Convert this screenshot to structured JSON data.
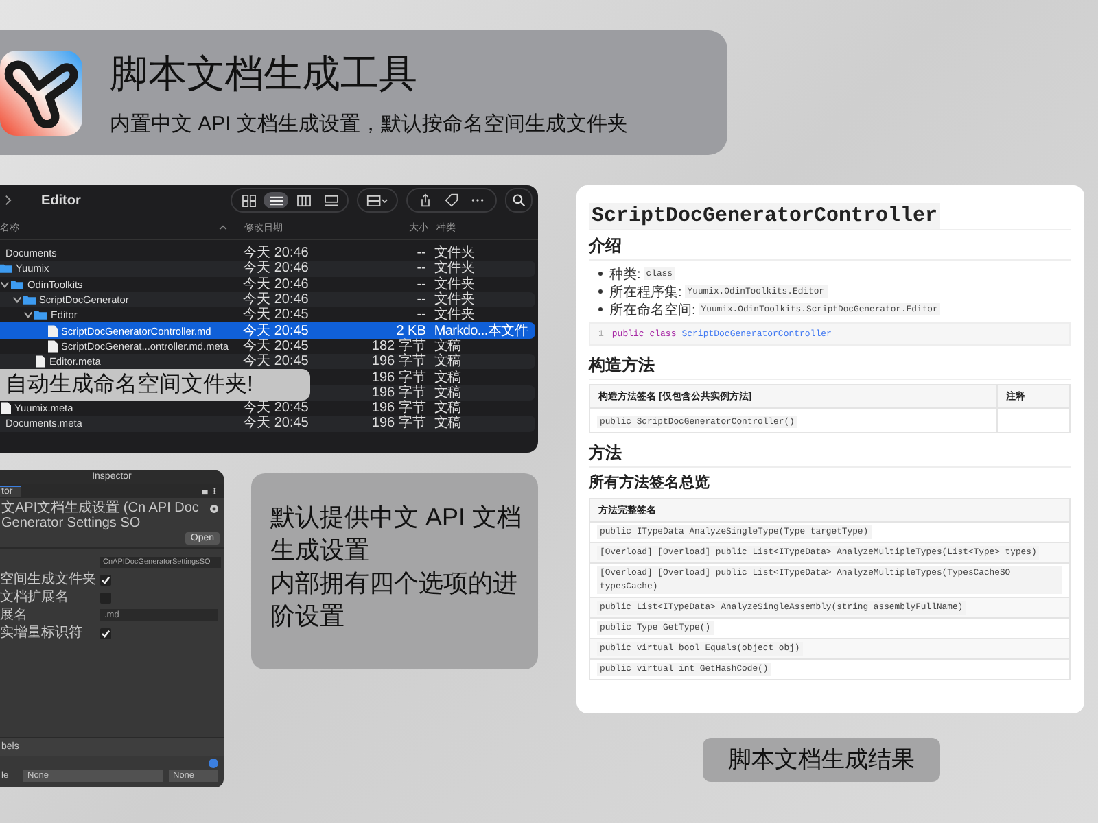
{
  "banner": {
    "title": "脚本文档生成工具",
    "subtitle": "内置中文 API 文档生成设置，默认按命名空间生成文件夹"
  },
  "finder": {
    "title": "Editor",
    "view_modes": [
      {
        "kind": "icons",
        "selected": false
      },
      {
        "kind": "list",
        "selected": true
      },
      {
        "kind": "columns",
        "selected": false
      },
      {
        "kind": "gallery",
        "selected": false
      }
    ],
    "columns": [
      "名称",
      "修改日期",
      "大小",
      "种类"
    ],
    "rows": [
      {
        "name": "Documents",
        "date": "今天 20:46",
        "size": "--",
        "kind_label": "文件夹",
        "selected": false,
        "children": [
          {
            "kind": "folder",
            "name": "Yuumix",
            "date": "今天 20:46",
            "size": "--",
            "kind_label": "文件夹",
            "selected": false,
            "children": [
              {
                "kind": "folder",
                "name": "OdinToolkits",
                "date": "今天 20:46",
                "size": "--",
                "kind_label": "文件夹",
                "selected": false,
                "expanded": true,
                "children": [
                  {
                    "kind": "folder",
                    "name": "ScriptDocGenerator",
                    "date": "今天 20:46",
                    "size": "--",
                    "kind_label": "文件夹",
                    "selected": false,
                    "expanded": true,
                    "children": [
                      {
                        "kind": "folder",
                        "name": "Editor",
                        "date": "今天 20:45",
                        "size": "--",
                        "kind_label": "文件夹",
                        "selected": false,
                        "expanded": true,
                        "children": [
                          {
                            "kind": "file",
                            "name": "ScriptDocGeneratorController.md",
                            "date": "今天 20:45",
                            "size": "2 KB",
                            "kind_label": "Markdo...本文件",
                            "selected": true
                          },
                          {
                            "kind": "file",
                            "name": "ScriptDocGenerat...ontroller.md.meta",
                            "date": "今天 20:45",
                            "size": "182 字节",
                            "kind_label": "文稿",
                            "selected": false
                          }
                        ]
                      },
                      {
                        "kind": "file",
                        "name": "Editor.meta",
                        "date": "今天 20:45",
                        "size": "196 字节",
                        "kind_label": "文稿",
                        "selected": false
                      }
                    ]
                  },
                  {
                    "size": "196 字节",
                    "kind_label": "文稿",
                    "selected": false
                  }
                ]
              },
              {
                "size": "196 字节",
                "kind_label": "文稿",
                "selected": false
              }
            ]
          },
          {
            "kind": "file",
            "name": "Yuumix.meta",
            "date": "今天 20:45",
            "size": "196 字节",
            "kind_label": "文稿",
            "selected": false
          }
        ]
      },
      {
        "name": "Documents.meta",
        "date": "今天 20:45",
        "size": "196 字节",
        "kind_label": "文稿",
        "selected": false
      }
    ],
    "callout": "自动生成命名空间文件夹!"
  },
  "inspector": {
    "title": "Inspector",
    "tab": "tor",
    "header": "文API文档生成设置 (Cn API Doc Generator Settings SO",
    "open_button": "Open",
    "fields": [
      {
        "kind": "object",
        "value": "CnAPIDocGeneratorSettingsSO"
      },
      {
        "kind": "checkbox",
        "label": "空间生成文件夹",
        "checked": true
      },
      {
        "kind": "checkbox",
        "label": "文档扩展名",
        "checked": false
      },
      {
        "kind": "text",
        "label": "展名",
        "value": ".md"
      },
      {
        "kind": "checkbox",
        "label": "实增量标识符",
        "checked": true
      }
    ],
    "section": "bels",
    "dropdown_label": "le",
    "dropdowns": [
      "None",
      "None"
    ]
  },
  "note": {
    "lines": [
      "默认提供中文 API 文档生成设置",
      "内部拥有四个选项的进阶设置"
    ]
  },
  "doc": {
    "title": "ScriptDocGeneratorController",
    "intro": {
      "heading": "介绍",
      "items": [
        {
          "label": "种类:",
          "code": "class"
        },
        {
          "label": "所在程序集:",
          "code": "Yuumix.OdinToolkits.Editor"
        },
        {
          "label": "所在命名空间:",
          "code": "Yuumix.OdinToolkits.ScriptDocGenerator.Editor"
        }
      ],
      "code_line": {
        "number": "1",
        "keyword": "public class",
        "name": "ScriptDocGeneratorController"
      }
    },
    "constructors": {
      "heading": "构造方法",
      "columns": [
        "构造方法签名 [仅包含公共实例方法]",
        "注释"
      ],
      "rows": [
        "public ScriptDocGeneratorController()"
      ]
    },
    "methods": {
      "heading": "方法",
      "subheading": "所有方法签名总览",
      "column": "方法完整签名",
      "rows": [
        "public ITypeData AnalyzeSingleType(Type targetType)",
        "[Overload] [Overload] public List<ITypeData> AnalyzeMultipleTypes(List<Type> types)",
        "[Overload] [Overload] public List<ITypeData> AnalyzeMultipleTypes(TypesCacheSO typesCache)",
        "public List<ITypeData> AnalyzeSingleAssembly(string assemblyFullName)",
        "public Type GetType()",
        "public virtual bool Equals(object obj)",
        "public virtual int GetHashCode()"
      ]
    }
  },
  "caption": "脚本文档生成结果"
}
